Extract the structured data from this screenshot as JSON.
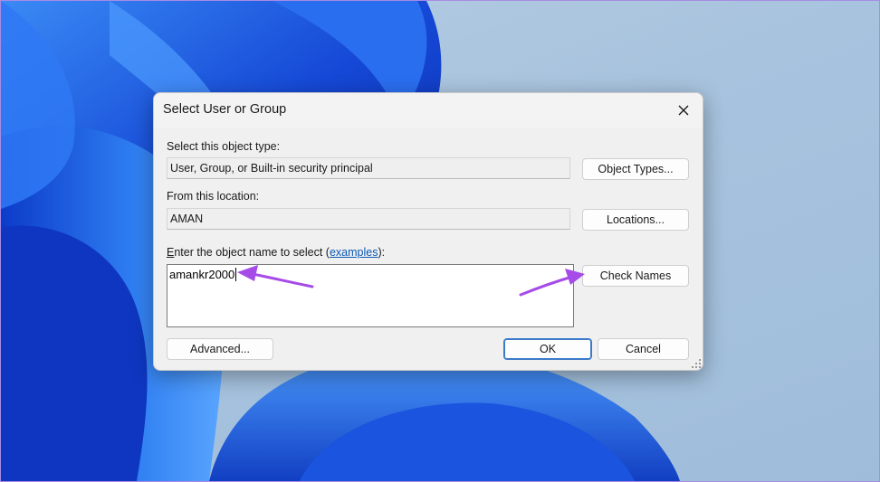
{
  "dialog": {
    "title": "Select User or Group",
    "object_type_label": "Select this object type:",
    "object_type_value": "User, Group, or Built-in security principal",
    "object_types_button": "Object Types...",
    "location_label": "From this location:",
    "location_value": "AMAN",
    "locations_button": "Locations...",
    "object_name_label_prefix_u": "E",
    "object_name_label_prefix": "nter the object name to select (",
    "examples_link": "examples",
    "object_name_label_suffix": "):",
    "object_name_value": "amankr2000",
    "check_names_button": "Check Names",
    "advanced_button": "Advanced...",
    "ok_button": "OK",
    "cancel_button": "Cancel"
  },
  "colors": {
    "annotation_arrow": "#a64be8",
    "wallpaper_blue": "#1f4fd8",
    "link": "#0a58b5"
  }
}
